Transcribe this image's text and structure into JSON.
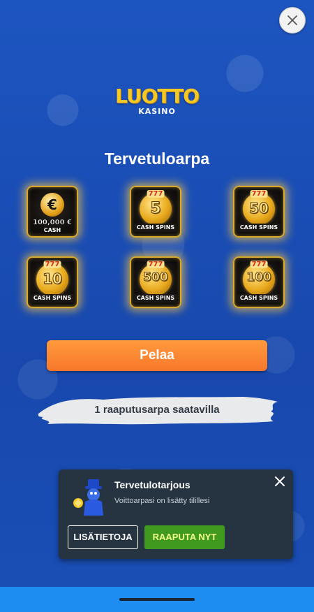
{
  "app": {
    "logo_text": "LUOTTO",
    "logo_sub": "KASINO"
  },
  "welcome": {
    "title": "Tervetuloarpa"
  },
  "prizes": [
    {
      "value": "100,000 €",
      "label": "CASH",
      "icon": "euro-coin-icon"
    },
    {
      "value": "5",
      "label": "CASH SPINS",
      "icon": "slot-coin-icon"
    },
    {
      "value": "50",
      "label": "CASH SPINS",
      "icon": "slot-coin-icon"
    },
    {
      "value": "10",
      "label": "CASH SPINS",
      "icon": "slot-coin-icon"
    },
    {
      "value": "500",
      "label": "CASH SPINS",
      "icon": "slot-coin-icon"
    },
    {
      "value": "100",
      "label": "CASH SPINS",
      "icon": "slot-coin-icon"
    }
  ],
  "reels_text": "777",
  "play_button": "Pelaa",
  "available_text": "1 raaputusarpa saatavilla",
  "toast": {
    "title": "Tervetulotarjous",
    "message": "Voittoarpasi on lisätty tilillesi",
    "info_button": "LISÄTIETOJA",
    "scratch_button": "RAAPUTA NYT"
  },
  "colors": {
    "background": "#1a4fb6",
    "accent_orange": "#f7772a",
    "toast_bg": "#263442",
    "scratch_green": "#3f9a1f",
    "navbar": "#1e8df2"
  }
}
